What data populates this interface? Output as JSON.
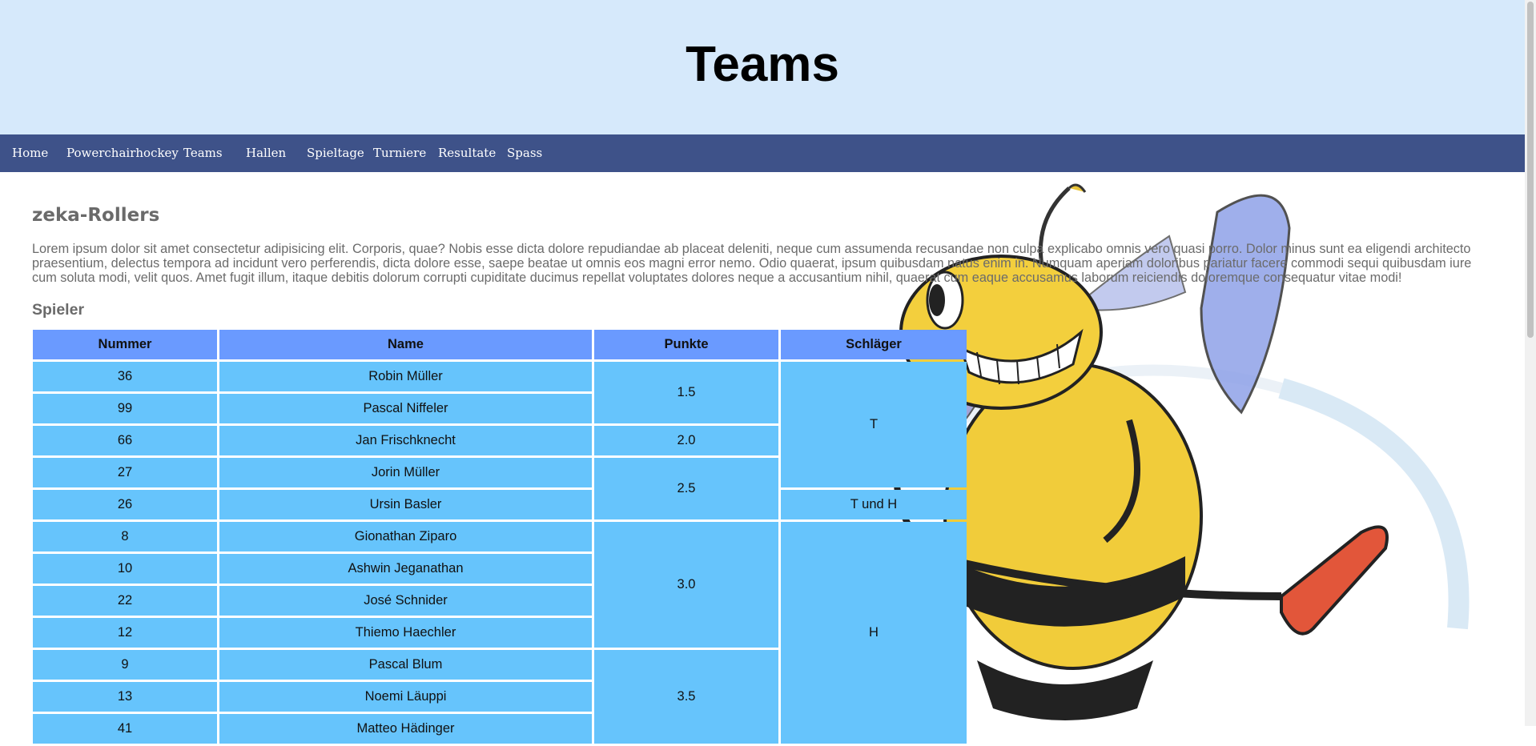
{
  "page": {
    "title": "Teams"
  },
  "nav": {
    "items": [
      {
        "label": "Home"
      },
      {
        "label": "Powerchairhockey"
      },
      {
        "label": "Teams"
      },
      {
        "label": "Hallen"
      },
      {
        "label": "Spieltage"
      },
      {
        "label": "Turniere"
      },
      {
        "label": "Resultate"
      },
      {
        "label": "Spass"
      }
    ],
    "background": "#3e5289"
  },
  "team": {
    "name": "zeka-Rollers",
    "description": "Lorem ipsum dolor sit amet consectetur adipisicing elit. Corporis, quae? Nobis esse dicta dolore repudiandae ab placeat deleniti, neque cum assumenda recusandae non culpa explicabo omnis vero quasi porro. Dolor minus sunt ea eligendi architecto praesentium, delectus tempora ad incidunt vero perferendis, dicta dolore esse, saepe beatae ut omnis eos magni error nemo. Odio quaerat, ipsum quibusdam natus enim in. Numquam aperiam doloribus pariatur facere commodi sequi quibusdam iure cum soluta modi, velit quos. Amet fugit illum, itaque debitis dolorum corrupti cupiditate ducimus repellat voluptates dolores neque a accusantium nihil, quaerat cum eaque accusamus laborum reiciendis doloremque consequatur vitae modi!",
    "players_heading": "Spieler"
  },
  "table": {
    "headers": {
      "number": "Nummer",
      "name": "Name",
      "points": "Punkte",
      "stick": "Schläger"
    },
    "rows": [
      {
        "number": "36",
        "name": "Robin Müller"
      },
      {
        "number": "99",
        "name": "Pascal Niffeler"
      },
      {
        "number": "66",
        "name": "Jan Frischknecht"
      },
      {
        "number": "27",
        "name": "Jorin Müller"
      },
      {
        "number": "26",
        "name": "Ursin Basler"
      },
      {
        "number": "8",
        "name": "Gionathan Ziparo"
      },
      {
        "number": "10",
        "name": "Ashwin Jeganathan"
      },
      {
        "number": "22",
        "name": "José Schnider"
      },
      {
        "number": "12",
        "name": "Thiemo Haechler"
      },
      {
        "number": "9",
        "name": "Pascal Blum"
      },
      {
        "number": "13",
        "name": "Noemi Läuppi"
      },
      {
        "number": "41",
        "name": "Matteo Hädinger"
      }
    ],
    "points_groups": [
      "1.5",
      "2.0",
      "2.5",
      "3.0",
      "3.5"
    ],
    "stick_groups": [
      "T",
      "T und H",
      "H"
    ],
    "header_color": "#6a9aff",
    "cell_color": "#66c4fc"
  },
  "colors": {
    "header_bg": "#d6e9fb"
  },
  "icons": {
    "mascot": "bee-hockey-mascot"
  }
}
